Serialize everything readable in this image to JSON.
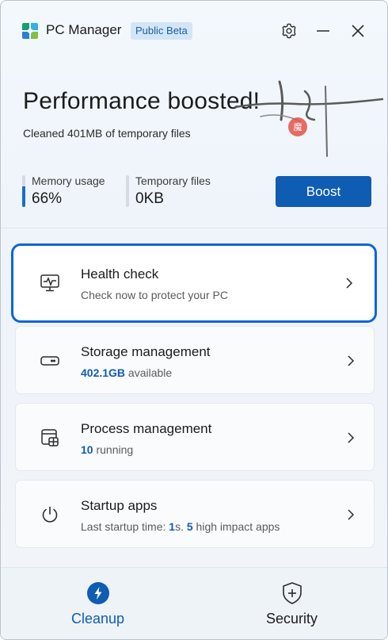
{
  "app": {
    "title": "PC Manager",
    "badge": "Public Beta"
  },
  "colors": {
    "accent": "#0f5cb3",
    "focus_ring": "#0d65d6",
    "badge_bg": "#d3e5f8"
  },
  "icons": {
    "app_logo": "pc-manager-logo-icon",
    "settings": "gear-icon",
    "minimize": "minimize-icon",
    "close": "close-icon"
  },
  "hero": {
    "title": "Performance boosted!",
    "subtitle": "Cleaned 401MB of temporary files",
    "stamp_text": "魔"
  },
  "stats": {
    "memory": {
      "label": "Memory usage",
      "value": "66%",
      "fraction": 0.66
    },
    "temp": {
      "label": "Temporary files",
      "value": "0KB",
      "fraction": 0.0
    }
  },
  "boost_label": "Boost",
  "cards": {
    "health": {
      "title": "Health check",
      "subtitle": "Check now to protect your PC",
      "icon": "health-monitor-icon"
    },
    "storage": {
      "title": "Storage management",
      "amount": "402.1GB",
      "suffix": " available",
      "icon": "storage-drive-icon"
    },
    "process": {
      "title": "Process management",
      "count": "10",
      "suffix": " running",
      "icon": "process-icon"
    },
    "startup": {
      "title": "Startup apps",
      "prefix": "Last startup time: ",
      "time": "1",
      "mid": "s. ",
      "count": "5",
      "suffix": " high impact apps",
      "icon": "power-icon"
    }
  },
  "nav": {
    "cleanup": {
      "label": "Cleanup",
      "icon": "lightning-icon",
      "active": true
    },
    "security": {
      "label": "Security",
      "icon": "shield-plus-icon",
      "active": false
    }
  }
}
